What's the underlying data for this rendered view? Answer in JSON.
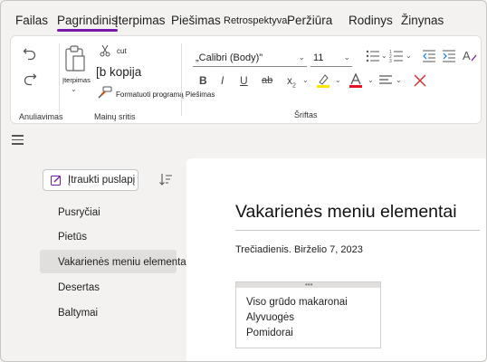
{
  "menu": {
    "tabs": [
      {
        "label": "Failas"
      },
      {
        "label": "Pagrindinis"
      },
      {
        "label": "Įterpimas"
      },
      {
        "label": "Piešimas"
      },
      {
        "label": "Retrospektyva"
      },
      {
        "label": "Peržiūra"
      },
      {
        "label": "Rodinys"
      },
      {
        "label": "Žinynas"
      }
    ]
  },
  "ribbon": {
    "undo_group_label": "Anuliavimas",
    "clipboard": {
      "paste_label": "Įterpimas",
      "cut_label": "cut",
      "copy_label": "[b kopija",
      "format_painter_label": "Formatuoti programą Piešimas",
      "group_label": "Mainų sritis"
    },
    "font": {
      "font_name": "„Calibri (Body)\"",
      "font_size": "11",
      "group_label": "Šriftas",
      "bold": "B",
      "italic": "I",
      "underline": "U",
      "strike": "ab",
      "subscript": "x",
      "font_color": "A"
    },
    "colors": {
      "highlight": "#ffe600",
      "font_color": "#e81123",
      "accent": "#7719aa",
      "clear_x": "#d13438"
    }
  },
  "pages_panel": {
    "add_page_label": "Įtraukti puslapį",
    "items": [
      {
        "label": "Pusryčiai"
      },
      {
        "label": "Pietūs"
      },
      {
        "label": "Vakarienės meniu elementai"
      },
      {
        "label": "Desertas"
      },
      {
        "label": "Baltymai"
      }
    ]
  },
  "page": {
    "title": "Vakarienės meniu elementai",
    "date": "Trečiadienis. Birželio 7, 2023",
    "note_lines": [
      {
        "text": "Viso grūdo makaronai"
      },
      {
        "text": "Alyvuogės"
      },
      {
        "text": "Pomidorai"
      }
    ]
  }
}
